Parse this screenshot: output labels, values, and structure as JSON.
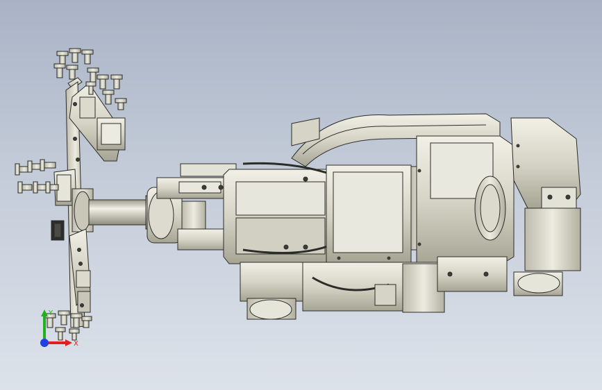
{
  "view": {
    "background_top": "#a9b3c5",
    "background_bottom": "#dde2ea",
    "model_color": "#d8d6c8",
    "edge_color": "#2b2b28"
  },
  "triad": {
    "x_label": "X",
    "y_label": "Y",
    "x_color": "#e02020",
    "y_color": "#20b020",
    "z_color": "#2040e0"
  },
  "icons": [
    "coordinate-triad-icon"
  ]
}
